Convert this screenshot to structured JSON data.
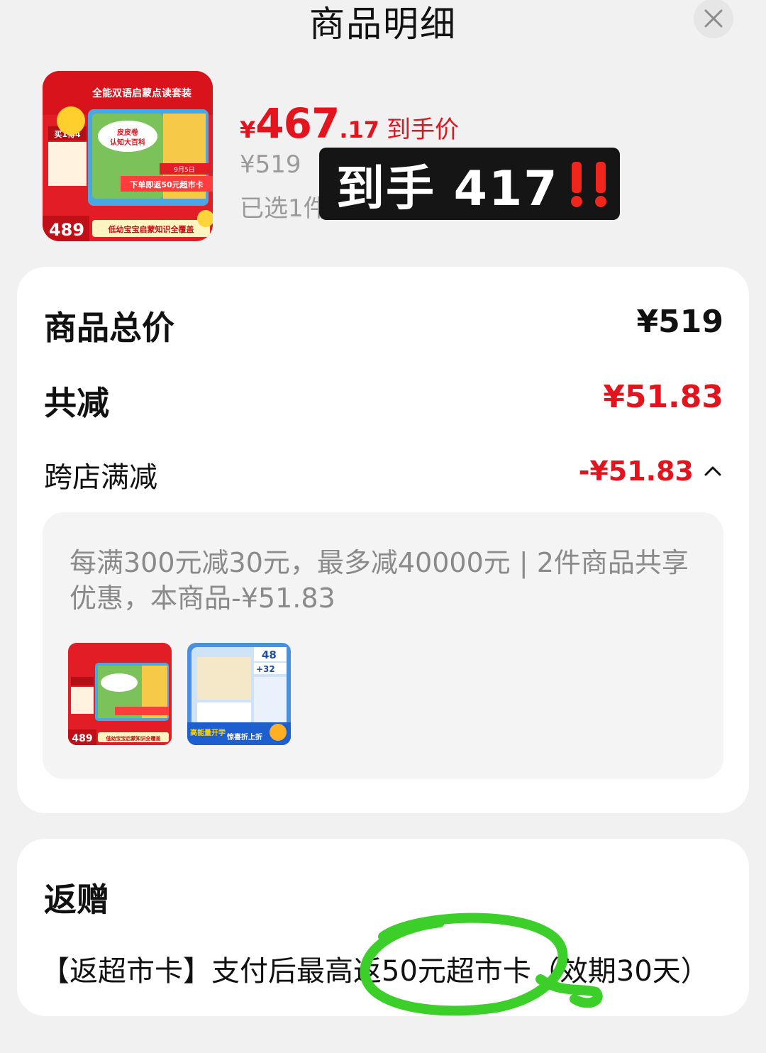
{
  "header": {
    "title": "商品明细"
  },
  "product": {
    "price_currency": "¥",
    "price_int": "467",
    "price_dec": ".17",
    "price_label": "到手价",
    "original_price": "¥519",
    "selected_text": "已选1件",
    "thumb_texts": {
      "title": "全能双语启蒙点读套装",
      "book": "皮皮卷",
      "book2": "认知大百科",
      "tag": "买1得4",
      "date": "9月5日",
      "coupon": "下单即返50元超市卡",
      "price": "489",
      "tagline": "低幼宝宝启蒙知识全覆盖"
    }
  },
  "overlay": {
    "text": "到手 417",
    "emoji": "!!"
  },
  "summary": {
    "total_label": "商品总价",
    "total_value": "¥519",
    "discount_label": "共减",
    "discount_value": "¥51.83",
    "cross_store_label": "跨店满减",
    "cross_store_value": "-¥51.83"
  },
  "promo": {
    "text": "每满300元减30元，最多减40000元 | 2件商品共享优惠，本商品-¥51.83",
    "item1": {
      "price": "489",
      "tagline": "低幼宝宝启蒙知识全覆盖"
    },
    "item2": {
      "count1": "48",
      "count2": "+32",
      "bottom1": "高能量开学",
      "bottom2": "惊喜折上折"
    }
  },
  "gift": {
    "title": "返赠",
    "text": "【返超市卡】支付后最高返50元超市卡（效期30天）"
  },
  "colors": {
    "accent_red": "#e4141e",
    "highlight_green": "#3ccf2a"
  }
}
